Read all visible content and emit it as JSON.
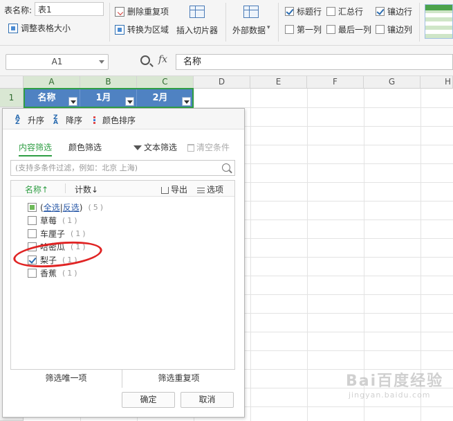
{
  "ribbon": {
    "table_name_label": "表名称:",
    "table_name_value": "表1",
    "resize_table": "调整表格大小",
    "remove_duplicates": "删除重复项",
    "convert_to_range": "转换为区域",
    "insert_slicer": "插入切片器",
    "external_data": "外部数据",
    "options": [
      {
        "label": "标题行",
        "checked": true
      },
      {
        "label": "汇总行",
        "checked": false
      },
      {
        "label": "镶边行",
        "checked": true
      },
      {
        "label": "第一列",
        "checked": false
      },
      {
        "label": "最后一列",
        "checked": false
      },
      {
        "label": "镶边列",
        "checked": false
      }
    ]
  },
  "formula_bar": {
    "cell_ref": "A1",
    "fx": "fx",
    "content": "名称"
  },
  "grid": {
    "columns": [
      "A",
      "B",
      "C",
      "D",
      "E",
      "F",
      "G",
      "H"
    ],
    "rows": [
      "1"
    ],
    "header_row": [
      "名称",
      "1月",
      "2月"
    ]
  },
  "filter": {
    "sort_asc": "升序",
    "sort_desc": "降序",
    "sort_color": "颜色排序",
    "tab_content": "内容筛选",
    "tab_color": "颜色筛选",
    "text_filter": "文本筛选",
    "clear_conditions": "清空条件",
    "search_placeholder": "(支持多条件过滤，例如：北京 上海)",
    "col_name": "名称↑",
    "col_count": "计数↓",
    "export": "导出",
    "options": "选项",
    "select_all": "全选",
    "invert": "反选",
    "select_all_count": "(5)",
    "items": [
      {
        "label": "草莓",
        "count": "(1)",
        "checked": false
      },
      {
        "label": "车厘子",
        "count": "(1)",
        "checked": false
      },
      {
        "label": "哈密瓜",
        "count": "(1)",
        "checked": false
      },
      {
        "label": "梨子",
        "count": "(1)",
        "checked": true
      },
      {
        "label": "香蕉",
        "count": "(1)",
        "checked": false
      }
    ],
    "filter_unique": "筛选唯一项",
    "filter_duplicates": "筛选重复项",
    "ok": "确定",
    "cancel": "取消"
  },
  "watermark": {
    "main": "Bai百度经验",
    "sub": "jingyan.baidu.com"
  }
}
